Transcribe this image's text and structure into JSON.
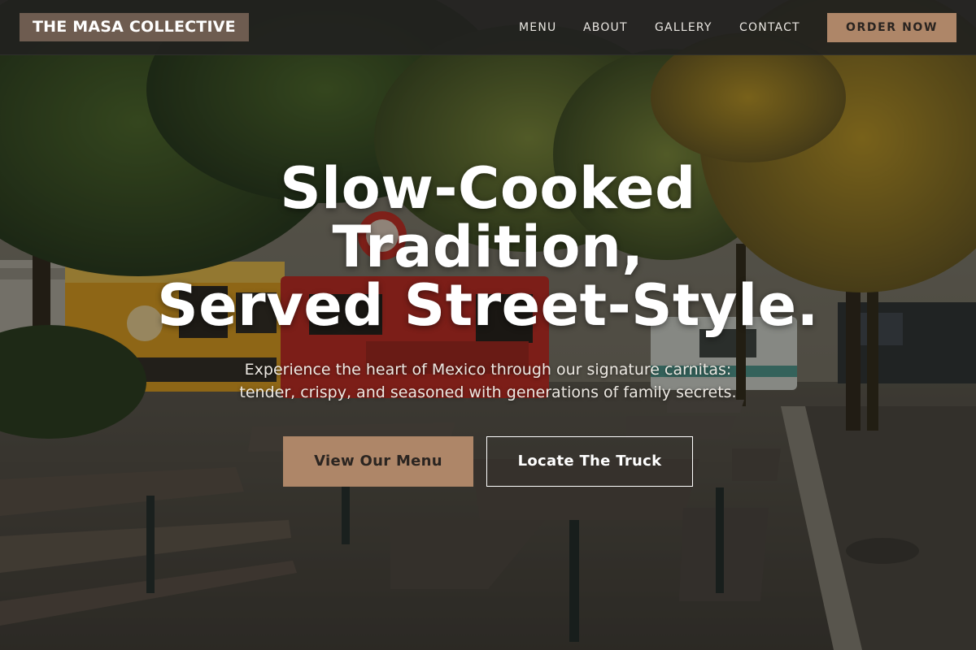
{
  "brand": {
    "name": "THE MASA COLLECTIVE",
    "logo_bg": "#6e5c50",
    "accent": "#ae8668"
  },
  "nav": {
    "links": [
      "MENU",
      "ABOUT",
      "GALLERY",
      "CONTACT"
    ],
    "cta": "ORDER NOW"
  },
  "hero": {
    "title_lines": [
      "Slow-Cooked",
      "Tradition,",
      "Served Street-Style."
    ],
    "subtitle_lines": [
      "Experience the heart of Mexico through our signature carnitas:",
      "tender, crispy, and seasoned with generations of family secrets."
    ],
    "primary_button": "View Our Menu",
    "secondary_button": "Locate The Truck",
    "background_image": "food-truck-park-photo"
  }
}
